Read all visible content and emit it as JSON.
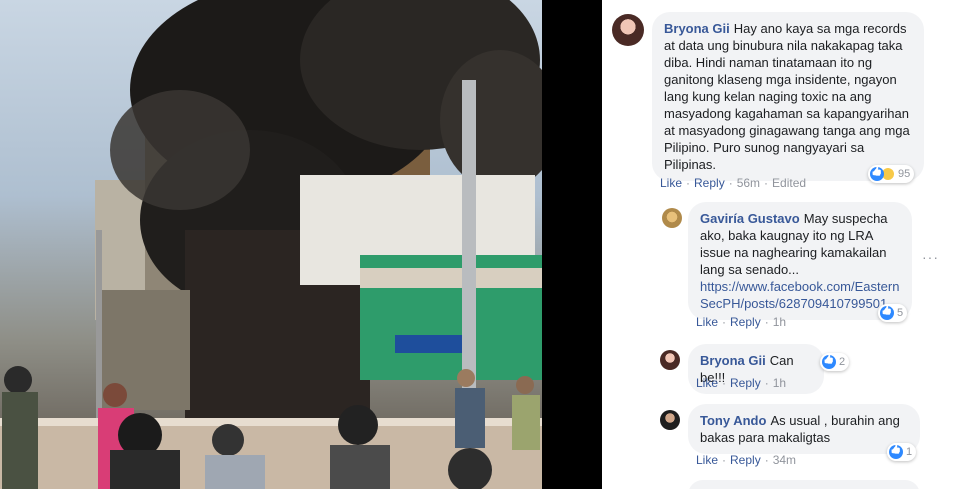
{
  "photo": {
    "caption_icon": "fire-photo"
  },
  "comments": [
    {
      "author": "Bryona Gii",
      "text": "Hay ano kaya sa mga records at data ung binubura nila nakakapag taka diba. Hindi naman tinatamaan ito ng ganitong klaseng mga insidente, ngayon lang kung kelan naging toxic na ang masyadong kagahaman sa kapangyarihan at masyadong ginagawang tanga ang mga Pilipino. Puro sunog nangyayari sa Pilipinas.",
      "like": "Like",
      "reply": "Reply",
      "time": "56m",
      "edited": "Edited",
      "reactions": "95"
    },
    {
      "author": "Gaviría Gustavo",
      "text": "May suspecha ako, baka kaugnay ito ng LRA issue na naghearing kamakailan lang sa senado...",
      "link": "https://www.facebook.com/EasternSecPH/posts/628709410799501",
      "like": "Like",
      "reply": "Reply",
      "time": "1h",
      "reactions": "5"
    },
    {
      "author": "Bryona Gii",
      "text": "Can be!!!",
      "like": "Like",
      "reply": "Reply",
      "time": "1h",
      "reactions": "2"
    },
    {
      "author": "Tony Ando",
      "text": "As usual , burahin ang bakas para makaligtas",
      "like": "Like",
      "reply": "Reply",
      "time": "34m",
      "reactions": "1"
    }
  ],
  "more_icon": "···"
}
